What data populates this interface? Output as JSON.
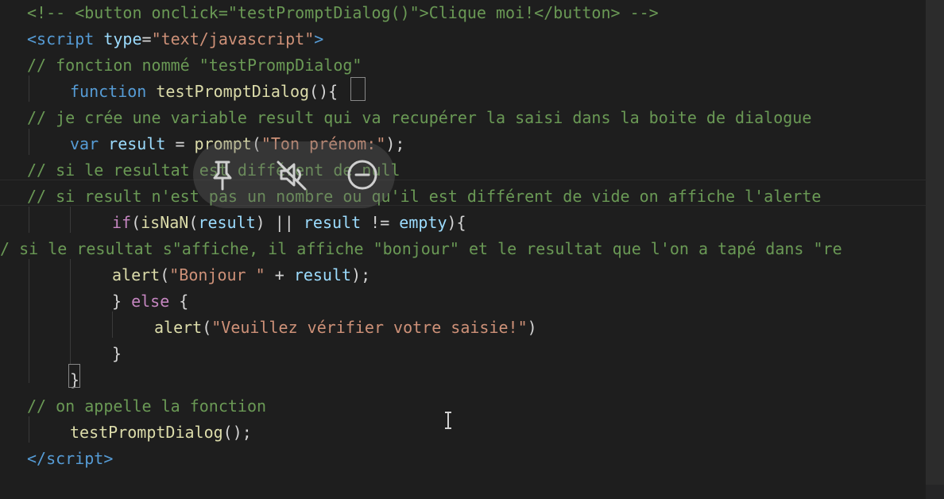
{
  "editor": {
    "lines": [
      [
        {
          "t": "<!-- <button onclick=\"testPromptDialog()\">Clique moi!</button> -->",
          "c": "comment"
        }
      ],
      [
        {
          "t": "<",
          "c": "tag"
        },
        {
          "t": "script",
          "c": "tag"
        },
        {
          "t": " ",
          "c": "punct"
        },
        {
          "t": "type",
          "c": "attr"
        },
        {
          "t": "=",
          "c": "punct"
        },
        {
          "t": "\"text/javascript\"",
          "c": "string"
        },
        {
          "t": ">",
          "c": "tag"
        }
      ],
      [
        {
          "t": "// fonction nommé \"testPrompDialog\"",
          "c": "comment"
        }
      ],
      [
        {
          "t": "function",
          "c": "keyword"
        },
        {
          "t": " ",
          "c": "punct"
        },
        {
          "t": "testPromptDialog",
          "c": "func"
        },
        {
          "t": "()",
          "c": "punct"
        },
        {
          "t": "{",
          "c": "bracket"
        }
      ],
      [
        {
          "t": "// je crée une variable result qui va recupérer la saisi dans la boite de dialogue",
          "c": "comment"
        }
      ],
      [
        {
          "t": "var",
          "c": "keyword"
        },
        {
          "t": " ",
          "c": "punct"
        },
        {
          "t": "result",
          "c": "var"
        },
        {
          "t": " = ",
          "c": "punct"
        },
        {
          "t": "prompt",
          "c": "func"
        },
        {
          "t": "(",
          "c": "punct"
        },
        {
          "t": "\"Ton prénom:\"",
          "c": "string"
        },
        {
          "t": ");",
          "c": "punct"
        }
      ],
      [
        {
          "t": "// si le resultat est différent de null",
          "c": "comment"
        }
      ],
      [
        {
          "t": "// si result n'est pas un nombre ou qu'il est différent de vide on affiche l'alerte",
          "c": "comment"
        }
      ],
      [
        {
          "t": "if",
          "c": "control"
        },
        {
          "t": "(",
          "c": "punct"
        },
        {
          "t": "isNaN",
          "c": "func"
        },
        {
          "t": "(",
          "c": "punct"
        },
        {
          "t": "result",
          "c": "var"
        },
        {
          "t": ") || ",
          "c": "punct"
        },
        {
          "t": "result",
          "c": "var"
        },
        {
          "t": " != ",
          "c": "punct"
        },
        {
          "t": "empty",
          "c": "var"
        },
        {
          "t": "){",
          "c": "punct"
        }
      ],
      [
        {
          "t": "/ si le resultat s\"affiche, il affiche \"bonjour\" et le resultat que l'on a tapé dans \"re",
          "c": "comment"
        }
      ],
      [
        {
          "t": "alert",
          "c": "func"
        },
        {
          "t": "(",
          "c": "punct"
        },
        {
          "t": "\"Bonjour \"",
          "c": "string"
        },
        {
          "t": " + ",
          "c": "punct"
        },
        {
          "t": "result",
          "c": "var"
        },
        {
          "t": ");",
          "c": "punct"
        }
      ],
      [
        {
          "t": "} ",
          "c": "punct"
        },
        {
          "t": "else",
          "c": "control"
        },
        {
          "t": " {",
          "c": "punct"
        }
      ],
      [
        {
          "t": "alert",
          "c": "func"
        },
        {
          "t": "(",
          "c": "punct"
        },
        {
          "t": "\"Veuillez vérifier votre saisie!\"",
          "c": "string"
        },
        {
          "t": ")",
          "c": "punct"
        }
      ],
      [
        {
          "t": "}",
          "c": "punct"
        }
      ],
      [
        {
          "t": "}",
          "c": "bracket"
        }
      ],
      [
        {
          "t": "// on appelle la fonction",
          "c": "comment"
        }
      ],
      [
        {
          "t": "testPromptDialog",
          "c": "func"
        },
        {
          "t": "();",
          "c": "punct"
        }
      ],
      [
        {
          "t": "</",
          "c": "tag"
        },
        {
          "t": "script",
          "c": "tag"
        },
        {
          "t": ">",
          "c": "tag"
        }
      ]
    ]
  },
  "overlay": {
    "buttons": [
      {
        "name": "pin-icon",
        "label": "Pin"
      },
      {
        "name": "mute-icon",
        "label": "Mute"
      },
      {
        "name": "close-circle-icon",
        "label": "Close"
      }
    ]
  },
  "colors": {
    "background": "#1e1e1e",
    "comment": "#6a9955",
    "keyword": "#569cd6",
    "control": "#c586c0",
    "function": "#dcdcaa",
    "variable": "#9cdcfe",
    "string": "#ce9178",
    "text": "#d4d4d4"
  }
}
